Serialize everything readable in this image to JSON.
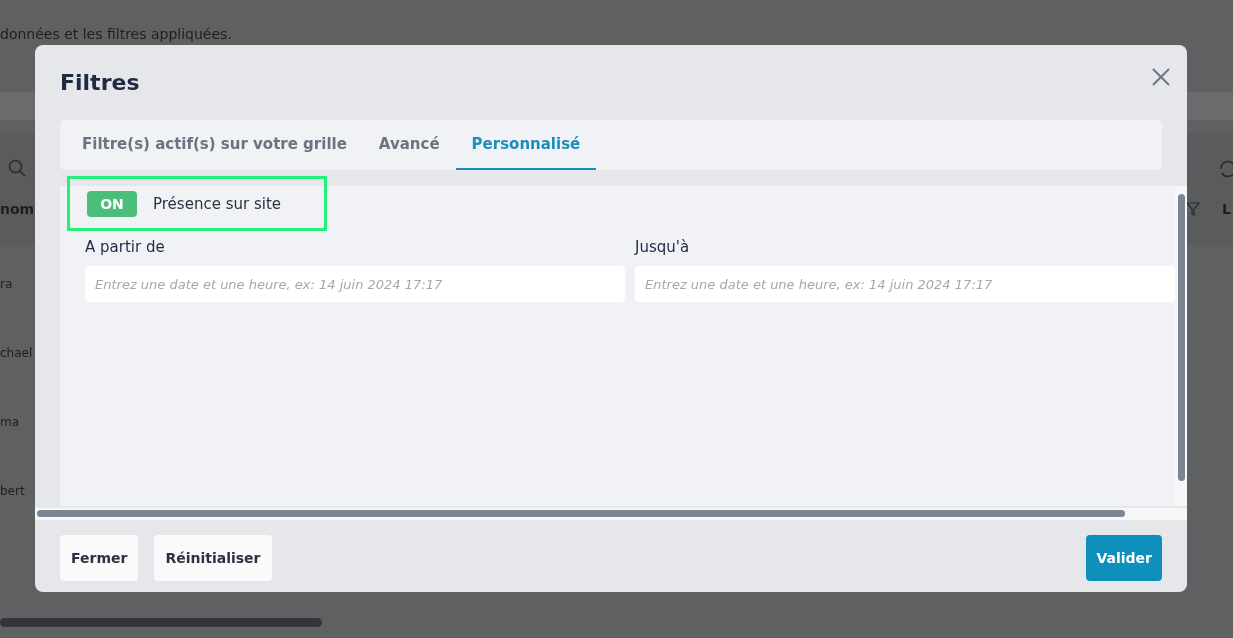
{
  "background": {
    "description": "données et les filtres appliquées.",
    "column_header": "nom",
    "right_header": "L",
    "rows": [
      "ra",
      "chael",
      "ma",
      "bert"
    ]
  },
  "dialog": {
    "title": "Filtres",
    "tabs": [
      {
        "label": "Filtre(s) actif(s) sur votre grille",
        "selected": false
      },
      {
        "label": "Avancé",
        "selected": false
      },
      {
        "label": "Personnalisé",
        "selected": true
      }
    ],
    "toggle": {
      "label": "ON",
      "on": true,
      "text": "Présence sur site",
      "highlighted": true
    },
    "fields": [
      {
        "label": "A partir de",
        "placeholder": "Entrez une date et une heure, ex: 14 juin 2024 17:17"
      },
      {
        "label": "Jusqu'à",
        "placeholder": "Entrez une date et une heure, ex: 14 juin 2024 17:17"
      }
    ],
    "buttons": [
      {
        "label": "Fermer",
        "kind": "secondary"
      },
      {
        "label": "Réinitialiser",
        "kind": "secondary"
      },
      {
        "label": "Valider",
        "kind": "primary"
      }
    ]
  }
}
